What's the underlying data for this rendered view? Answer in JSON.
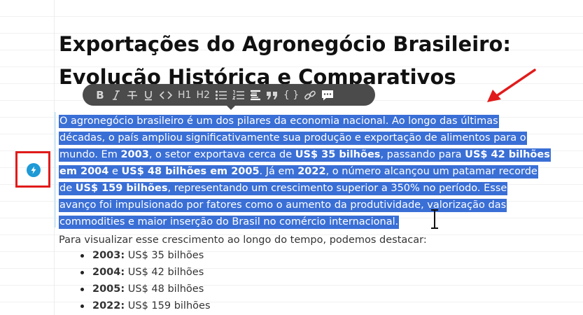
{
  "document": {
    "title_lines": [
      "Exportações do Agronegócio Brasileiro:",
      "Evolução Histórica e Comparativos"
    ],
    "toolbar": [
      {
        "icon": "bold-icon",
        "glyph": "B"
      },
      {
        "icon": "italic-icon",
        "glyph": "I"
      },
      {
        "icon": "strikethrough-icon",
        "glyph": "T"
      },
      {
        "icon": "underline-icon",
        "glyph": "U"
      },
      {
        "icon": "code-icon",
        "glyph": "<>"
      },
      {
        "icon": "heading1-icon",
        "glyph": "H1"
      },
      {
        "icon": "heading2-icon",
        "glyph": "H2"
      },
      {
        "icon": "bulleted-list-icon",
        "glyph": ""
      },
      {
        "icon": "numbered-list-icon",
        "glyph": ""
      },
      {
        "icon": "checklist-icon",
        "glyph": ""
      },
      {
        "icon": "quote-icon",
        "glyph": "❞"
      },
      {
        "icon": "code-block-icon",
        "glyph": "{ }"
      },
      {
        "icon": "link-icon",
        "glyph": ""
      },
      {
        "icon": "comment-icon",
        "glyph": ""
      }
    ],
    "selected_paragraph": {
      "l1": "O agronegócio brasileiro é um dos pilares da economia nacional. Ao longo das últimas",
      "l2": "décadas, o país ampliou significativamente sua produção e exportação de alimentos para o",
      "l3a": "mundo. Em ",
      "l3b": "2003",
      "l3c": ", o setor exportava cerca de ",
      "l3d": "US$ 35 bilhões",
      "l3e": ", passando para ",
      "l3f": "US$ 42 bilhões",
      "l4a": "em 2004",
      "l4b": " e ",
      "l4c": "US$ 48 bilhões em 2005",
      "l4d": ". Já em ",
      "l4e": "2022",
      "l4f": ", o número alcançou um patamar recorde",
      "l5a": "de ",
      "l5b": "US$ 159 bilhões",
      "l5c": ", representando um crescimento superior a 350% no período. Esse",
      "l6": "avanço foi impulsionado por fatores como o aumento da produtividade, valorização das",
      "l7": "commodities e maior inserção do Brasil no comércio internacional."
    },
    "intro": "Para visualizar esse crescimento ao longo do tempo, podemos destacar:",
    "list": [
      {
        "year": "2003:",
        "value": " US$ 35 bilhões"
      },
      {
        "year": "2004:",
        "value": " US$ 42 bilhões"
      },
      {
        "year": "2005:",
        "value": " US$ 48 bilhões"
      },
      {
        "year": "2022:",
        "value": " US$ 159 bilhões"
      }
    ]
  },
  "colors": {
    "selection": "#3a6fd6",
    "toolbar_bg": "#4b4b4b",
    "annotation_red": "#e11b1b",
    "lightning_blue": "#1e9ad6"
  }
}
